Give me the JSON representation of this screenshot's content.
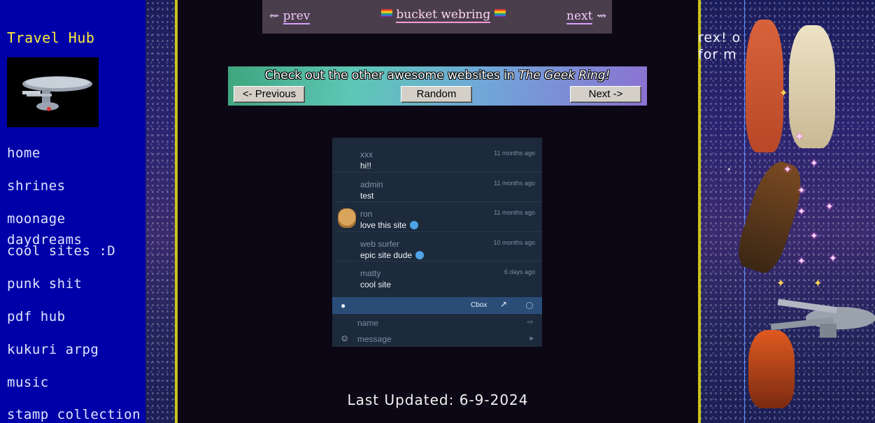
{
  "sidebar": {
    "site_title": "Travel Hub",
    "nav": [
      "home",
      "shrines",
      "moonage daydreams",
      "cool sites :D",
      "punk shit",
      "pdf hub",
      "kukuri arpg",
      "music",
      "stamp collection"
    ]
  },
  "webring": {
    "prev_arrow": "⇜",
    "prev": "prev",
    "title": "bucket webring",
    "next": "next",
    "next_arrow": "⇝"
  },
  "geek_ring": {
    "message_prefix": "Check out the other awesome websites in ",
    "message_ring": "The Geek Ring!",
    "previous": "<- Previous",
    "random": "Random",
    "next": "Next ->"
  },
  "cbox": {
    "messages": [
      {
        "author": "xxx",
        "text": "hi!!",
        "time": "11 months ago"
      },
      {
        "author": "admin",
        "text": "test",
        "time": "11 months ago"
      },
      {
        "author": "ron",
        "text": "love this site",
        "time": "11 months ago"
      },
      {
        "author": "web surfer",
        "text": "epic site dude",
        "time": "10 months ago"
      },
      {
        "author": "matty",
        "text": "cool site",
        "time": "6 days ago"
      }
    ],
    "brand": "Cbox",
    "name_placeholder": "name",
    "message_placeholder": "message"
  },
  "footer": {
    "last_updated": "Last Updated: 6-9-2024"
  },
  "right_panel": {
    "line1": "rex! o",
    "line2": "for m"
  },
  "colors": {
    "sidebar_bg": "#0000a8",
    "site_title": "#ffeb3b",
    "main_border": "#c9c21c",
    "cbox_bar": "#2a4d78"
  }
}
